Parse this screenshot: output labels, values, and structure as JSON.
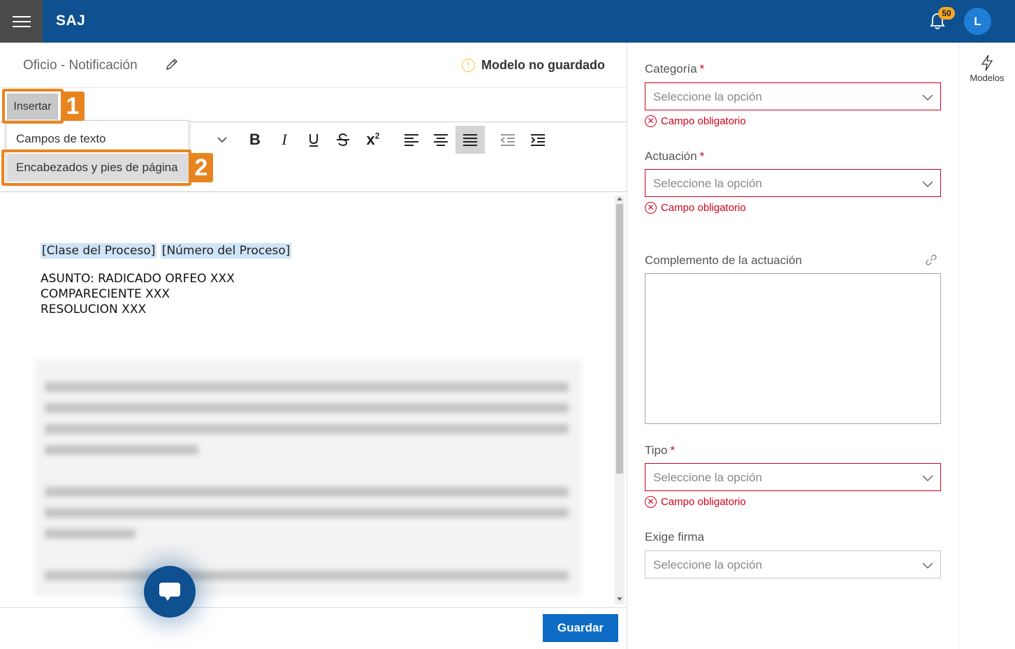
{
  "header": {
    "app_title": "SAJ",
    "notification_count": "50",
    "avatar_initial": "L",
    "brand_color": "#0e5090"
  },
  "editor": {
    "doc_title": "Oficio - Notificación",
    "status": "Modelo no guardado",
    "insert_label": "Insertar",
    "insert_menu": [
      "Campos de texto",
      "Encabezados y pies de página"
    ],
    "callouts": [
      "1",
      "2"
    ],
    "toolbar_icons": [
      "bold-icon",
      "italic-icon",
      "underline-icon",
      "strikethrough-icon",
      "superscript-icon",
      "align-left-icon",
      "align-center-icon",
      "align-justify-icon",
      "outdent-icon",
      "indent-icon"
    ],
    "active_tool": "align-justify-icon",
    "content": {
      "field1": "[Clase del Proceso]",
      "field2": "[Número del Proceso]",
      "line1": "ASUNTO: RADICADO ORFEO XXX",
      "line2": "COMPARECIENTE XXX",
      "line3": "RESOLUCION XXX"
    },
    "save_label": "Guardar"
  },
  "form": {
    "categoria": {
      "label": "Categoría",
      "placeholder": "Seleccione la opción",
      "error": "Campo obligatorio"
    },
    "actuacion": {
      "label": "Actuación",
      "placeholder": "Seleccione la opción",
      "error": "Campo obligatorio"
    },
    "complemento": {
      "label": "Complemento de la actuación",
      "value": ""
    },
    "tipo": {
      "label": "Tipo",
      "placeholder": "Seleccione la opción",
      "error": "Campo obligatorio"
    },
    "exige_firma": {
      "label": "Exige firma",
      "placeholder": "Seleccione la opción"
    },
    "required_mark": "*"
  },
  "side": {
    "models_label": "Modelos"
  }
}
